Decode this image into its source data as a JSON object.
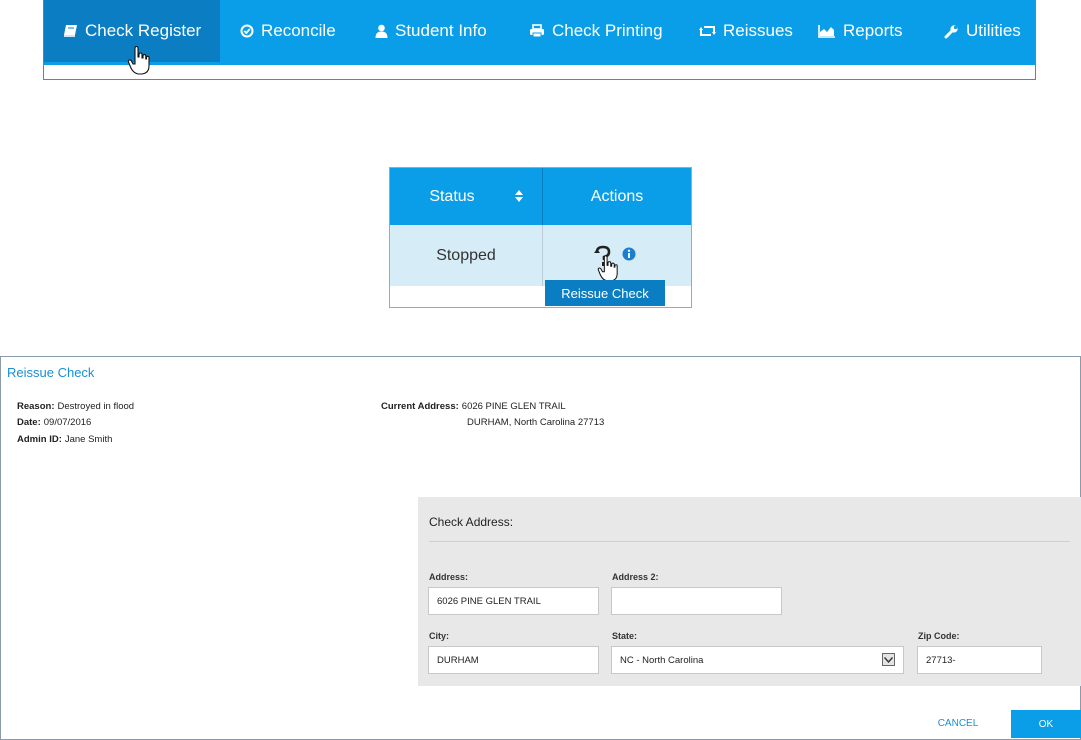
{
  "nav": {
    "items": [
      {
        "label": "Check Register",
        "icon": "book-icon",
        "active": true
      },
      {
        "label": "Reconcile",
        "icon": "check-circle-icon",
        "active": false
      },
      {
        "label": "Student Info",
        "icon": "user-icon",
        "active": false
      },
      {
        "label": "Check Printing",
        "icon": "printer-icon",
        "active": false
      },
      {
        "label": "Reissues",
        "icon": "retweet-icon",
        "active": false
      },
      {
        "label": "Reports",
        "icon": "area-chart-icon",
        "active": false
      },
      {
        "label": "Utilities",
        "icon": "wrench-icon",
        "active": false
      }
    ],
    "colors": {
      "bar": "#0b9ee8",
      "active": "#0a7dc3"
    }
  },
  "status_table": {
    "headers": [
      "Status",
      "Actions"
    ],
    "row": {
      "status": "Stopped",
      "actions": [
        "reissue-icon",
        "info-icon"
      ]
    },
    "tooltip": "Reissue Check",
    "colors": {
      "header": "#0b9ee8",
      "row": "#d6ecf7"
    }
  },
  "dialog": {
    "title": "Reissue Check",
    "reason_label": "Reason:",
    "reason": "Destroyed in flood",
    "date_label": "Date:",
    "date": "09/07/2016",
    "admin_label": "Admin ID:",
    "admin": "Jane Smith",
    "current_address_label": "Current Address:",
    "current_address_line1": "6026 PINE GLEN TRAIL",
    "current_address_line2": "DURHAM, North Carolina 27713",
    "check_address": {
      "title": "Check Address:",
      "address_label": "Address:",
      "address": "6026 PINE GLEN TRAIL",
      "address2_label": "Address 2:",
      "address2": "",
      "city_label": "City:",
      "city": "DURHAM",
      "state_label": "State:",
      "state": "NC - North Carolina",
      "zip_label": "Zip Code:",
      "zip": "27713-"
    },
    "cancel_label": "CANCEL",
    "ok_label": "OK"
  }
}
